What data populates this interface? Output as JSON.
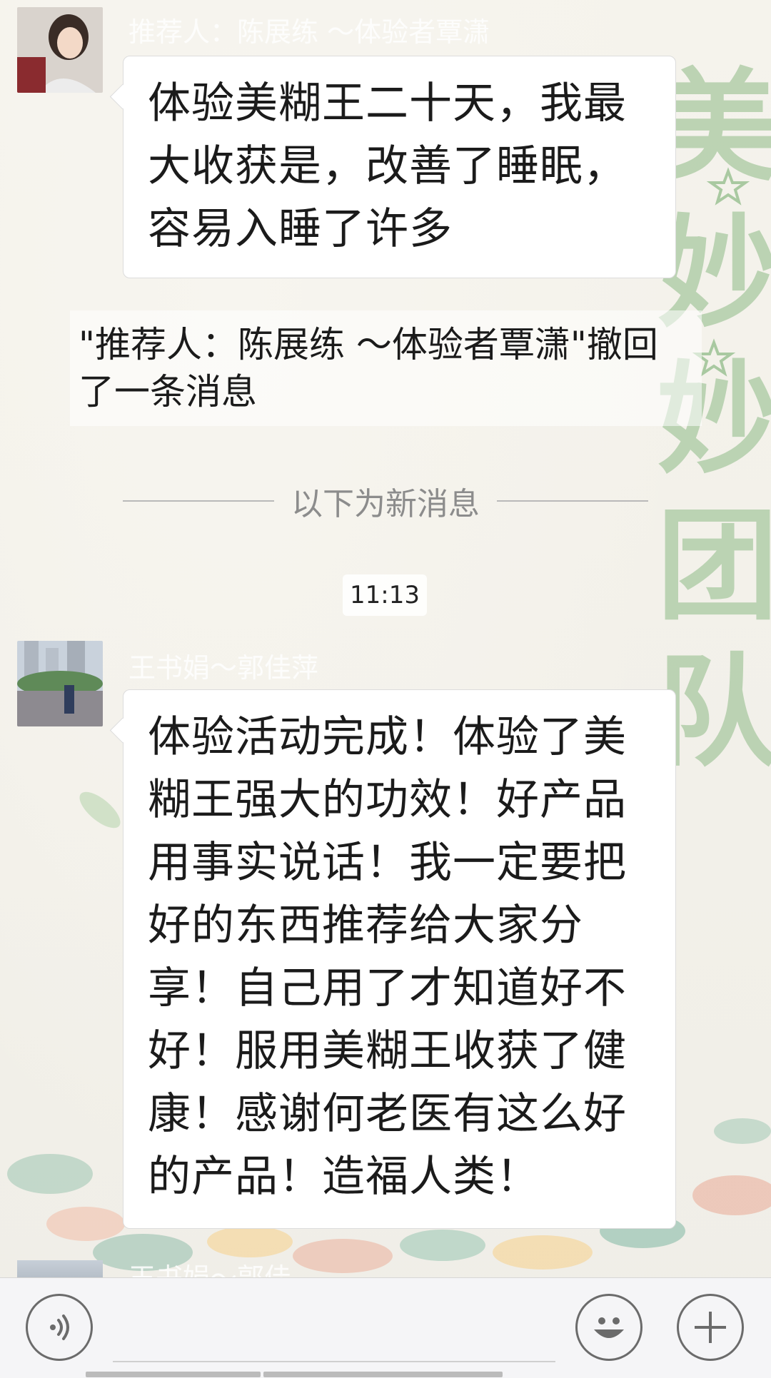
{
  "chat": {
    "messages": [
      {
        "sender": "推荐人：陈展练 ～体验者覃潇",
        "text": "体验美糊王二十天，我最大收获是，改善了睡眠，容易入睡了许多"
      },
      {
        "sender": "王书娟～郭佳萍",
        "text": "体验活动完成！体验了美糊王强大的功效！好产品用事实说话！我一定要把好的东西推荐给大家分享！自己用了才知道好不好！服用美糊王收获了健康！感谢何老医有这么好的产品！造福人类！"
      }
    ],
    "recall_notice": "\"推荐人：陈展练 ～体验者覃潇\"撤回了一条消息",
    "new_messages_divider": "以下为新消息",
    "timestamp": "11:13",
    "partial_sender": "王书娟～郭佳"
  },
  "background": {
    "side_text": [
      "美",
      "妙",
      "妙",
      "团",
      "队"
    ]
  },
  "input_bar": {
    "icons": [
      "voice-icon",
      "emoji-icon",
      "plus-icon"
    ]
  },
  "colors": {
    "bubble": "#ffffff",
    "bubble_border": "#dcdcdc",
    "divider_text": "#8c8c8c",
    "deco_green": "#a9c9a1",
    "input_bar_bg": "#f5f5f7"
  }
}
